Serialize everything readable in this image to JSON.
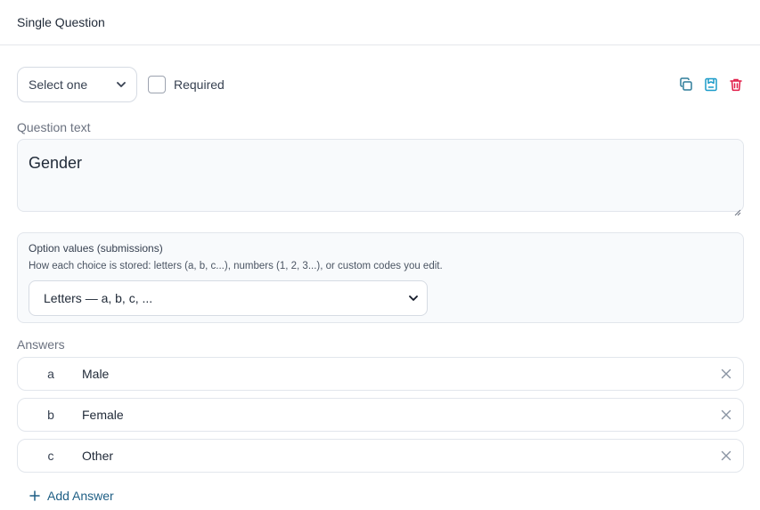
{
  "header": {
    "title": "Single Question"
  },
  "toolbar": {
    "type_select": {
      "value": "Select one"
    },
    "required_label": "Required",
    "colors": {
      "copy": "#2f7d9a",
      "save": "#1a9bc9",
      "delete": "#e11d48"
    }
  },
  "question": {
    "label": "Question text",
    "value": "Gender"
  },
  "option_values": {
    "title": "Option values (submissions)",
    "help": "How each choice is stored: letters (a, b, c...), numbers (1, 2, 3...), or custom codes you edit.",
    "select_value": "Letters — a, b, c, ..."
  },
  "answers": {
    "label": "Answers",
    "items": [
      {
        "key": "a",
        "value": "Male"
      },
      {
        "key": "b",
        "value": "Female"
      },
      {
        "key": "c",
        "value": "Other"
      }
    ],
    "add_label": "Add Answer"
  }
}
